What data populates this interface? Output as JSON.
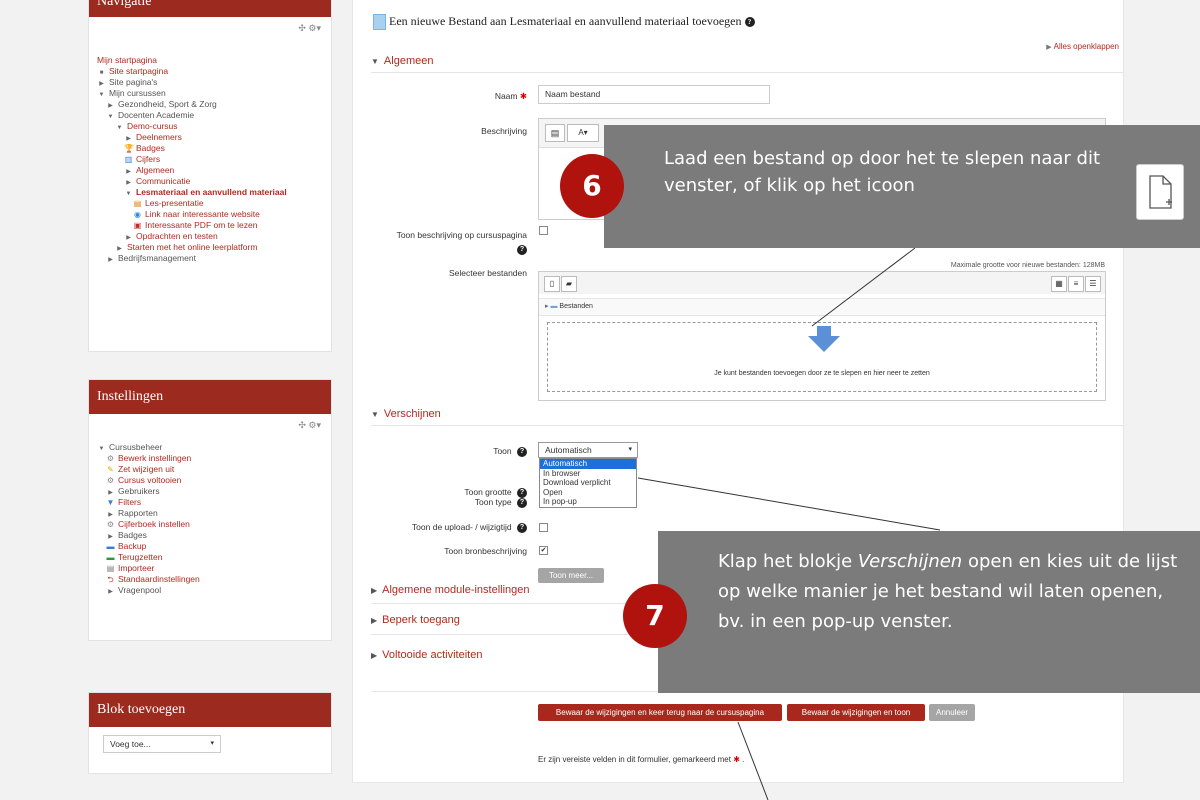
{
  "navigation": {
    "title": "Navigatie",
    "items": [
      {
        "label": "Mijn startpagina",
        "level": 0,
        "icon": "none",
        "style": "link"
      },
      {
        "label": "Site startpagina",
        "level": 0,
        "icon": "bullet",
        "style": "link"
      },
      {
        "label": "Site pagina's",
        "level": 0,
        "icon": "caret-right",
        "style": "grey"
      },
      {
        "label": "Mijn cursussen",
        "level": 0,
        "icon": "caret-down",
        "style": "grey"
      },
      {
        "label": "Gezondheid, Sport & Zorg",
        "level": 1,
        "icon": "caret-right",
        "style": "grey"
      },
      {
        "label": "Docenten Academie",
        "level": 1,
        "icon": "caret-down",
        "style": "grey"
      },
      {
        "label": "Demo-cursus",
        "level": 2,
        "icon": "caret-down",
        "style": "link"
      },
      {
        "label": "Deelnemers",
        "level": 3,
        "icon": "caret-right",
        "style": "link"
      },
      {
        "label": "Badges",
        "level": 3,
        "icon": "trophy",
        "style": "link"
      },
      {
        "label": "Cijfers",
        "level": 3,
        "icon": "grades",
        "style": "link"
      },
      {
        "label": "Algemeen",
        "level": 3,
        "icon": "caret-right",
        "style": "link"
      },
      {
        "label": "Communicatie",
        "level": 3,
        "icon": "caret-right",
        "style": "link"
      },
      {
        "label": "Lesmateriaal en aanvullend materiaal",
        "level": 3,
        "icon": "caret-down",
        "style": "bold"
      },
      {
        "label": "Les-presentatie",
        "level": 4,
        "icon": "ppt",
        "style": "link"
      },
      {
        "label": "Link naar interessante website",
        "level": 4,
        "icon": "url",
        "style": "link"
      },
      {
        "label": "Interessante PDF om te lezen",
        "level": 4,
        "icon": "pdf",
        "style": "link"
      },
      {
        "label": "Opdrachten en testen",
        "level": 3,
        "icon": "caret-right",
        "style": "link"
      },
      {
        "label": "Starten met het online leerplatform",
        "level": 2,
        "icon": "caret-right",
        "style": "link"
      },
      {
        "label": "Bedrijfsmanagement",
        "level": 1,
        "icon": "caret-right",
        "style": "grey"
      }
    ]
  },
  "settings": {
    "title": "Instellingen",
    "items": [
      {
        "label": "Cursusbeheer",
        "level": 0,
        "icon": "caret-down",
        "style": "grey"
      },
      {
        "label": "Bewerk instellingen",
        "level": 1,
        "icon": "gear",
        "style": "link"
      },
      {
        "label": "Zet wijzigen uit",
        "level": 1,
        "icon": "pencil",
        "style": "link"
      },
      {
        "label": "Cursus voltooien",
        "level": 1,
        "icon": "gear",
        "style": "link"
      },
      {
        "label": "Gebruikers",
        "level": 1,
        "icon": "caret-right",
        "style": "grey"
      },
      {
        "label": "Filters",
        "level": 1,
        "icon": "filter",
        "style": "link"
      },
      {
        "label": "Rapporten",
        "level": 1,
        "icon": "caret-right",
        "style": "grey"
      },
      {
        "label": "Cijferboek instellen",
        "level": 1,
        "icon": "gear",
        "style": "link"
      },
      {
        "label": "Badges",
        "level": 1,
        "icon": "caret-right",
        "style": "grey"
      },
      {
        "label": "Backup",
        "level": 1,
        "icon": "backup",
        "style": "link"
      },
      {
        "label": "Terugzetten",
        "level": 1,
        "icon": "restore",
        "style": "link"
      },
      {
        "label": "Importeer",
        "level": 1,
        "icon": "import",
        "style": "link"
      },
      {
        "label": "Standaardinstellingen",
        "level": 1,
        "icon": "reset",
        "style": "link"
      },
      {
        "label": "Vragenpool",
        "level": 1,
        "icon": "caret-right",
        "style": "grey"
      }
    ]
  },
  "add_block": {
    "title": "Blok toevoegen",
    "select_value": "Voeg toe..."
  },
  "main": {
    "page_title": "Een nieuwe Bestand aan Lesmateriaal en aanvullend materiaal toevoegen",
    "expand_all": "Alles openklappen",
    "sections": {
      "algemeen": "Algemeen",
      "verschijnen": "Verschijnen",
      "module": "Algemene module-instellingen",
      "beperk": "Beperk toegang",
      "voltooide": "Voltooide activiteiten"
    },
    "fields": {
      "naam_label": "Naam",
      "naam_value": "Naam bestand",
      "beschrijving_label": "Beschrijving",
      "toon_beschrijving_label": "Toon beschrijving op cursuspagina",
      "selecteer_label": "Selecteer bestanden",
      "max_size": "Maximale grootte voor nieuwe bestanden: 128MB",
      "folder_label": "Bestanden",
      "drop_hint": "Je kunt bestanden toevoegen door ze te slepen en hier neer te zetten",
      "toon_label": "Toon",
      "toon_value": "Automatisch",
      "toon_options": [
        "Automatisch",
        "In browser",
        "Download verplicht",
        "Open",
        "In pop-up"
      ],
      "toon_grootte_label": "Toon grootte",
      "toon_type_label": "Toon type",
      "toon_upload_label": "Toon de upload- / wijzigtijd",
      "toon_bron_label": "Toon bronbeschrijving",
      "toon_meer": "Toon meer..."
    },
    "buttons": {
      "save_return": "Bewaar de wijzigingen en keer terug naar de cursuspagina",
      "save_show": "Bewaar de wijzigingen en toon",
      "cancel": "Annuleer"
    },
    "required_note": "Er zijn vereiste velden in dit formulier, gemarkeerd met"
  },
  "callouts": {
    "c6_number": "6",
    "c6_text": "Laad een bestand op door het te slepen naar dit venster, of klik op het icoon",
    "c7_number": "7",
    "c7_pre": "Klap het blokje ",
    "c7_em": "Verschijnen",
    "c7_post": " open en kies uit de lijst op welke manier je het bestand wil laten openen, bv. in een pop-up venster."
  },
  "colors": {
    "brand": "#9c2a1f",
    "link": "#b02a1e",
    "callout_bg": "#7b7b7b",
    "badge": "#b0120d",
    "selected_option": "#1e6fd9"
  }
}
